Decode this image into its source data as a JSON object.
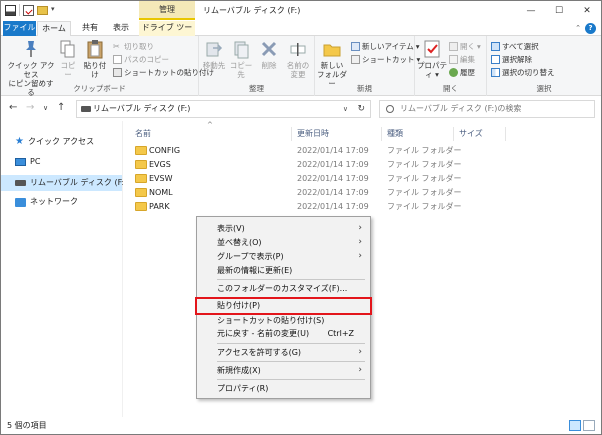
{
  "window": {
    "title": "リムーバブル ディスク (F:)",
    "context_tab": "管理"
  },
  "ribbon_tabs": {
    "file": "ファイル",
    "home": "ホーム",
    "share": "共有",
    "view": "表示",
    "drive_tools": "ドライブ ツール"
  },
  "ribbon": {
    "clipboard": {
      "pin_line1": "クイック アクセス",
      "pin_line2": "にピン留めする",
      "copy": "コピー",
      "paste": "貼り付け",
      "cut": "切り取り",
      "copy_path": "パスのコピー",
      "paste_shortcut": "ショートカットの貼り付け",
      "label": "クリップボード"
    },
    "organize": {
      "move_to": "移動先",
      "copy_to": "コピー先",
      "delete": "削除",
      "rename_line1": "名前の",
      "rename_line2": "変更",
      "label": "整理"
    },
    "new": {
      "new_folder_line1": "新しい",
      "new_folder_line2": "フォルダー",
      "new_item": "新しいアイテム",
      "easy_access": "ショートカット",
      "label": "新規"
    },
    "open": {
      "properties": "プロパティ",
      "open": "開く",
      "edit": "編集",
      "history": "履歴",
      "label": "開く"
    },
    "select": {
      "select_all": "すべて選択",
      "select_none": "選択解除",
      "invert": "選択の切り替え",
      "label": "選択"
    }
  },
  "address": {
    "path": "リムーバブル ディスク (F:)",
    "search_placeholder": "リムーバブル ディスク (F:)の検索"
  },
  "nav_pane": {
    "quick_access": "クイック アクセス",
    "pc": "PC",
    "removable_disk": "リムーバブル ディスク (F:)",
    "network": "ネットワーク"
  },
  "columns": {
    "name": "名前",
    "modified": "更新日時",
    "type": "種類",
    "size": "サイズ"
  },
  "files": [
    {
      "name": "CONFIG",
      "date": "2022/01/14 17:09",
      "type": "ファイル フォルダー"
    },
    {
      "name": "EVGS",
      "date": "2022/01/14 17:09",
      "type": "ファイル フォルダー"
    },
    {
      "name": "EVSW",
      "date": "2022/01/14 17:09",
      "type": "ファイル フォルダー"
    },
    {
      "name": "NOML",
      "date": "2022/01/14 17:09",
      "type": "ファイル フォルダー"
    },
    {
      "name": "PARK",
      "date": "2022/01/14 17:09",
      "type": "ファイル フォルダー"
    }
  ],
  "context_menu": {
    "view": "表示(V)",
    "sort_by": "並べ替え(O)",
    "group_by": "グループで表示(P)",
    "refresh": "最新の情報に更新(E)",
    "customize": "このフォルダーのカスタマイズ(F)...",
    "paste": "貼り付け(P)",
    "paste_shortcut": "ショートカットの貼り付け(S)",
    "undo_rename": "元に戻す - 名前の変更(U)",
    "undo_shortcut": "Ctrl+Z",
    "give_access": "アクセスを許可する(G)",
    "new": "新規作成(X)",
    "properties": "プロパティ(R)"
  },
  "status": {
    "item_count": "5 個の項目"
  },
  "colors": {
    "file_tab": "#1979ca",
    "selection": "#cce8ff",
    "highlight_box": "#e3151b",
    "folder": "#f4c84a"
  }
}
